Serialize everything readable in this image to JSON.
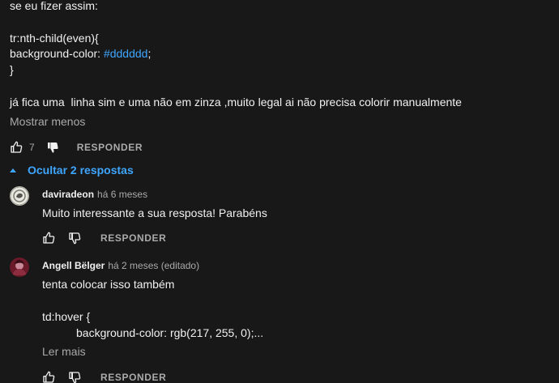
{
  "comment": {
    "lines": [
      "se eu fizer assim:",
      "tr:nth-child(even){",
      "background-color: ",
      "#dddddd",
      ";",
      "}",
      "já fica uma  linha sim e uma não em zinza ,muito legal ai não precisa colorir manualmente"
    ],
    "show_less": "Mostrar menos",
    "like_count": "7",
    "reply_label": "RESPONDER"
  },
  "replies_toggle": "Ocultar 2 respostas",
  "replies": [
    {
      "author": "daviradeon",
      "time": "há 6 meses",
      "text": "Muito interessante a sua resposta! Parabéns",
      "reply_label": "RESPONDER"
    },
    {
      "author": "Angell Bëlger",
      "time": "há 2 meses (editado)",
      "text_line1": "tenta colocar isso também",
      "text_line2": "td:hover {",
      "text_line3": "background-color: rgb(217, 255, 0);...",
      "read_more": "Ler mais",
      "reply_label": "RESPONDER"
    }
  ],
  "colors": {
    "background": "#181818",
    "text": "#f1f1f1",
    "muted": "#aaaaaa",
    "accent": "#3ea6ff"
  },
  "icons": {
    "like": "thumbs-up-icon",
    "dislike": "thumbs-down-icon",
    "collapse": "caret-up-icon"
  }
}
